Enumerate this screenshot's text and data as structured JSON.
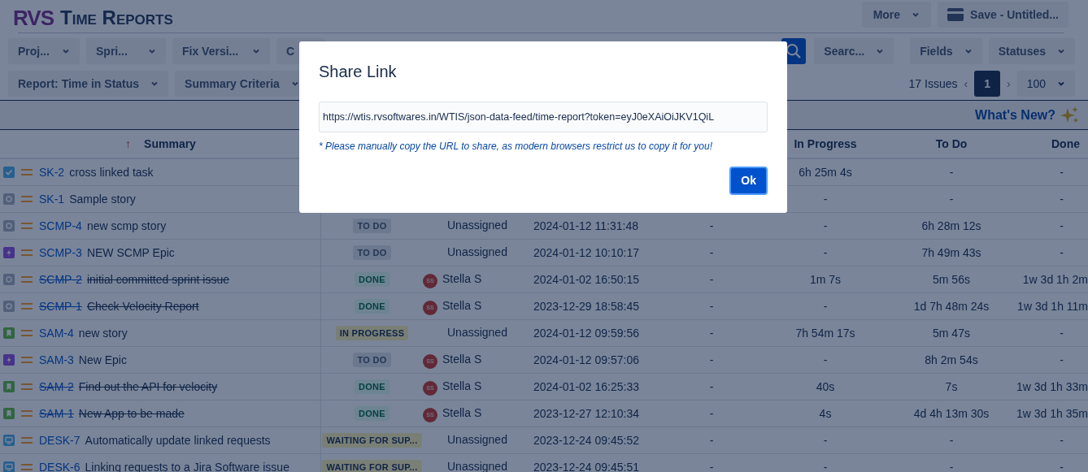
{
  "app": {
    "logo": "RVS",
    "title": "Time Reports"
  },
  "top_actions": [
    {
      "kind": "menu",
      "label": "More"
    },
    {
      "kind": "save",
      "label": "Save - Untitled..."
    }
  ],
  "filters": [
    {
      "label": "Proj..."
    },
    {
      "label": "Spri..."
    },
    {
      "label": "Fix Versi..."
    },
    {
      "label": "C"
    }
  ],
  "right_filters": [
    {
      "kind": "search"
    },
    {
      "kind": "menu",
      "label": "Searc..."
    },
    {
      "kind": "menu",
      "label": "Fields"
    },
    {
      "kind": "menu",
      "label": "Statuses"
    }
  ],
  "report_menus": [
    {
      "label": "Report: Time in Status"
    },
    {
      "label": "Summary Criteria"
    }
  ],
  "pagination": {
    "count": "17 Issues",
    "prev": "‹",
    "next": "›",
    "pages": [
      {
        "label": "1",
        "selected": true
      }
    ],
    "page_size": "100"
  },
  "whats_new": "What's New?",
  "header": {
    "sort_arrow": "↑",
    "summary": "Summary",
    "in_progress": "In Progress",
    "to_do": "To Do",
    "done": "Done"
  },
  "rows": [
    {
      "kind": "task",
      "key": "SK-2",
      "summary": "cross linked task",
      "resolved": false,
      "in_progress": "6h 25m 4s",
      "to_do": "-",
      "done": "-"
    },
    {
      "kind": "subtask",
      "key": "SK-1",
      "summary": "Sample story",
      "resolved": false,
      "in_progress": "-",
      "to_do": "-",
      "done": "-"
    },
    {
      "kind": "subtask",
      "key": "SCMP-4",
      "summary": "new scmp story",
      "resolved": false,
      "status": {
        "label": "TO DO",
        "color": "#6b788d"
      },
      "assignee": {
        "name": "Unassigned"
      },
      "date": "2024-01-12 11:31:48",
      "column_5": "-",
      "in_progress": "-",
      "to_do": "6h 28m 12s",
      "done": "-"
    },
    {
      "kind": "epic",
      "key": "SCMP-3",
      "summary": "NEW SCMP Epic",
      "resolved": false,
      "status": {
        "label": "TO DO",
        "color": "#6b788d"
      },
      "assignee": {
        "name": "Unassigned"
      },
      "date": "2024-01-12 10:10:17",
      "column_5": "-",
      "in_progress": "-",
      "to_do": "7h 49m 43s",
      "done": "-"
    },
    {
      "kind": "subtask",
      "key": "SCMP-2",
      "summary": "initial committed sprint issue",
      "resolved": true,
      "status": {
        "label": "DONE",
        "color": "#6d8492"
      },
      "assignee": {
        "name": "Stella S",
        "initials": "SS"
      },
      "date": "2024-01-02 16:50:15",
      "column_5": "-",
      "in_progress": "1m 7s",
      "to_do": "5m 56s",
      "done": "1w 3d 1h 2m"
    },
    {
      "kind": "subtask",
      "key": "SCMP-1",
      "summary": "Check Velocity Report",
      "resolved": true,
      "status": {
        "label": "DONE",
        "color": "#6d8492"
      },
      "assignee": {
        "name": "Stella S",
        "initials": "SS"
      },
      "date": "2023-12-29 18:58:45",
      "column_5": "-",
      "in_progress": "-",
      "to_do": "1d 7h 48m 24s",
      "done": "1w 3d 1h 11m"
    },
    {
      "kind": "story",
      "key": "SAM-4",
      "summary": "new story",
      "resolved": false,
      "status": {
        "label": "IN PROGRESS",
        "color": "#7a7f76"
      },
      "assignee": {
        "name": "Unassigned"
      },
      "date": "2024-01-12 09:59:56",
      "column_5": "-",
      "in_progress": "7h 54m 17s",
      "to_do": "5m 47s",
      "done": "-"
    },
    {
      "kind": "epic",
      "key": "SAM-3",
      "summary": "New Epic",
      "resolved": false,
      "status": {
        "label": "TO DO",
        "color": "#6b788d"
      },
      "assignee": {
        "name": "Stella S",
        "initials": "SS"
      },
      "date": "2024-01-12 09:57:06",
      "column_5": "-",
      "in_progress": "-",
      "to_do": "8h 2m 54s",
      "done": "-"
    },
    {
      "kind": "story",
      "key": "SAM-2",
      "summary": "Find out the API for velocity",
      "resolved": true,
      "status": {
        "label": "DONE",
        "color": "#6d8492"
      },
      "assignee": {
        "name": "Stella S",
        "initials": "SS"
      },
      "date": "2024-01-02 16:25:33",
      "column_5": "-",
      "in_progress": "40s",
      "to_do": "7s",
      "done": "1w 3d 1h 33m"
    },
    {
      "kind": "story",
      "key": "SAM-1",
      "summary": "New App to be made",
      "resolved": true,
      "status": {
        "label": "DONE",
        "color": "#6d8492"
      },
      "assignee": {
        "name": "Stella S",
        "initials": "SS"
      },
      "date": "2023-12-27 12:10:34",
      "column_5": "-",
      "in_progress": "4s",
      "to_do": "4d 4h 13m 30s",
      "done": "1w 3d 1h 35m"
    },
    {
      "kind": "request",
      "key": "DESK-7",
      "summary": "Automatically update linked requests",
      "resolved": false,
      "status": {
        "label": "WAITING FOR SUP...",
        "color": "#7a7f76"
      },
      "assignee": {
        "name": "Unassigned"
      },
      "date": "2023-12-24 09:45:52",
      "column_5": "-",
      "in_progress": "-",
      "to_do": "-",
      "done": "-"
    },
    {
      "kind": "request",
      "key": "DESK-6",
      "summary": "Linking requests to a Jira Software issue",
      "resolved": false,
      "status": {
        "label": "WAITING FOR SUP...",
        "color": "#7a7f76"
      },
      "assignee": {
        "name": "Unassigned"
      },
      "date": "2023-12-24 09:45:51",
      "column_5": "-",
      "in_progress": "-",
      "to_do": "-",
      "done": "-"
    }
  ],
  "modal": {
    "title": "Share Link",
    "url": "https://wtis.rvsoftwares.in/WTIS/json-data-feed/time-report?token=eyJ0eXAiOiJKV1QiL",
    "note": "* Please manually copy the URL to share, as modern browsers restrict us to copy it for you!",
    "ok": "Ok"
  }
}
